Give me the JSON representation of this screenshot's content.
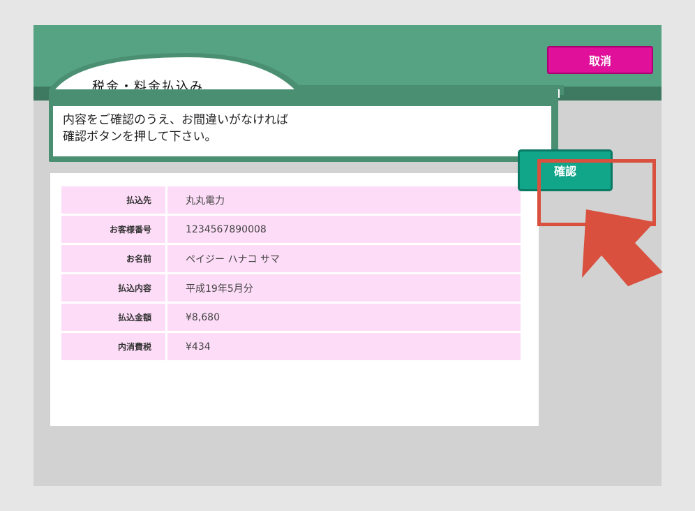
{
  "header": {
    "title": "税金・料金払込み",
    "cancel_label": "取消"
  },
  "message": {
    "line1": "内容をご確認のうえ、お間違いがなければ",
    "line2": "確認ボタンを押して下さい。"
  },
  "details": [
    {
      "label": "払込先",
      "value": "丸丸電力"
    },
    {
      "label": "お客様番号",
      "value": "1234567890008"
    },
    {
      "label": "お名前",
      "value": "ペイジー ハナコ サマ"
    },
    {
      "label": "払込内容",
      "value": "平成19年5月分"
    },
    {
      "label": "払込金額",
      "value": "¥8,680"
    },
    {
      "label": "内消費税",
      "value": "¥434"
    }
  ],
  "confirm_label": "確認",
  "colors": {
    "header_green": "#55a383",
    "cancel_magenta": "#e0109a",
    "confirm_teal": "#11a58a",
    "row_pink": "#fddcf7",
    "highlight_red": "#d9503f"
  }
}
